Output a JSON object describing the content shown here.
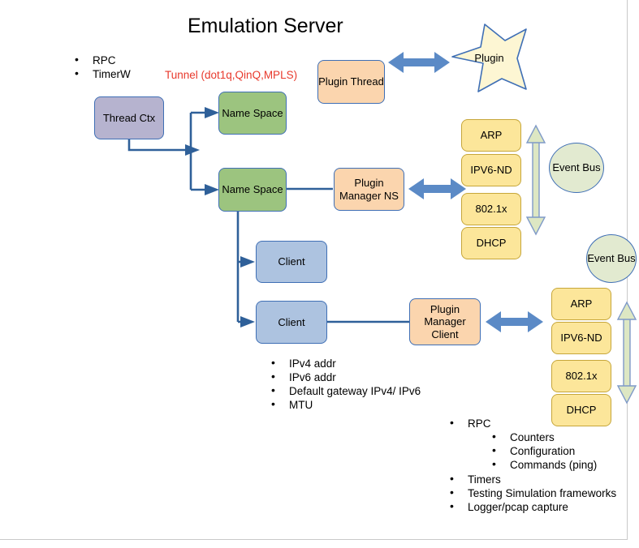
{
  "title": "Emulation Server",
  "top_left_bullets": [
    "RPC",
    "TimerW"
  ],
  "tunnel_note": "Tunnel (dot1q,QinQ,MPLS)",
  "nodes": {
    "thread_ctx": "Thread Ctx",
    "name_space_1": "Name Space",
    "name_space_2": "Name Space",
    "plugin_thread": "Plugin Thread",
    "plugin": "Plugin",
    "plugin_manager_ns": "Plugin Manager NS",
    "plugin_manager_client": "Plugin Manager Client",
    "client_1": "Client",
    "client_2": "Client",
    "event_bus_1": "Event Bus",
    "event_bus_2": "Event Bus"
  },
  "protocols_top": [
    "ARP",
    "IPV6-ND",
    "802.1x",
    "DHCP"
  ],
  "protocols_bottom": [
    "ARP",
    "IPV6-ND",
    "802.1x",
    "DHCP"
  ],
  "client_attributes": [
    "IPv4 addr",
    "IPv6 addr",
    "Default gateway IPv4/ IPv6",
    "MTU"
  ],
  "features": {
    "rpc": "RPC",
    "rpc_children": [
      "Counters",
      "Configuration",
      "Commands (ping)"
    ],
    "timers": "Timers",
    "testing": "Testing Simulation frameworks",
    "logger": "Logger/pcap capture"
  },
  "colors": {
    "purple": "#b6b3cf",
    "green": "#9cc47f",
    "blue": "#adc3e0",
    "orange": "#fbd5ae",
    "yellow": "#fce69a",
    "ellipse_green": "#e2ead0",
    "arrow_blue": "#5b8ac6",
    "arrow_green": "#dde7c3",
    "connector_blue": "#2f6099",
    "red_text": "#e8392c"
  }
}
